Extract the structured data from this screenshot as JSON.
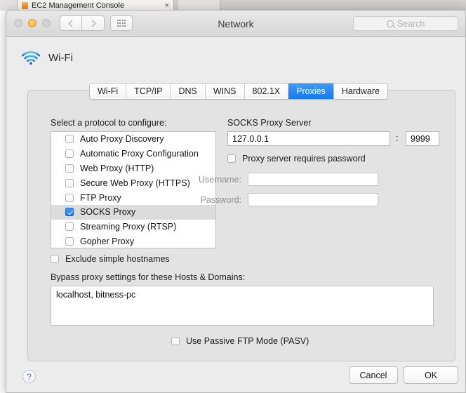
{
  "browser": {
    "tab_title": "EC2 Management Console",
    "tab_close": "×",
    "tab_left_close": "×",
    "favicon": "aws-cube-icon"
  },
  "window": {
    "title": "Network",
    "search_placeholder": "Search",
    "traffic_lights": [
      "close",
      "minimize",
      "zoom"
    ],
    "accent_blue": "#1679f5",
    "amber": "#fbbd40"
  },
  "service": {
    "name": "Wi-Fi",
    "icon": "wifi-icon"
  },
  "tabs": [
    {
      "label": "Wi-Fi",
      "selected": false
    },
    {
      "label": "TCP/IP",
      "selected": false
    },
    {
      "label": "DNS",
      "selected": false
    },
    {
      "label": "WINS",
      "selected": false
    },
    {
      "label": "802.1X",
      "selected": false
    },
    {
      "label": "Proxies",
      "selected": true
    },
    {
      "label": "Hardware",
      "selected": false
    }
  ],
  "proxies": {
    "protocol_list_label": "Select a protocol to configure:",
    "protocols": [
      {
        "label": "Auto Proxy Discovery",
        "checked": false,
        "selected": false
      },
      {
        "label": "Automatic Proxy Configuration",
        "checked": false,
        "selected": false
      },
      {
        "label": "Web Proxy (HTTP)",
        "checked": false,
        "selected": false
      },
      {
        "label": "Secure Web Proxy (HTTPS)",
        "checked": false,
        "selected": false
      },
      {
        "label": "FTP Proxy",
        "checked": false,
        "selected": false
      },
      {
        "label": "SOCKS Proxy",
        "checked": true,
        "selected": true
      },
      {
        "label": "Streaming Proxy (RTSP)",
        "checked": false,
        "selected": false
      },
      {
        "label": "Gopher Proxy",
        "checked": false,
        "selected": false
      }
    ],
    "server_label": "SOCKS Proxy Server",
    "server_host": "127.0.0.1",
    "port_separator": ":",
    "server_port": "9999",
    "requires_password_label": "Proxy server requires password",
    "requires_password_checked": false,
    "username_label": "Username:",
    "username_value": "",
    "password_label": "Password:",
    "password_value": "",
    "exclude_simple_hostnames_label": "Exclude simple hostnames",
    "exclude_simple_hostnames_checked": false,
    "bypass_label": "Bypass proxy settings for these Hosts & Domains:",
    "bypass_value": "localhost, bitness-pc",
    "passive_ftp_label": "Use Passive FTP Mode (PASV)",
    "passive_ftp_checked": false
  },
  "footer": {
    "help_label": "?",
    "cancel_label": "Cancel",
    "ok_label": "OK"
  }
}
